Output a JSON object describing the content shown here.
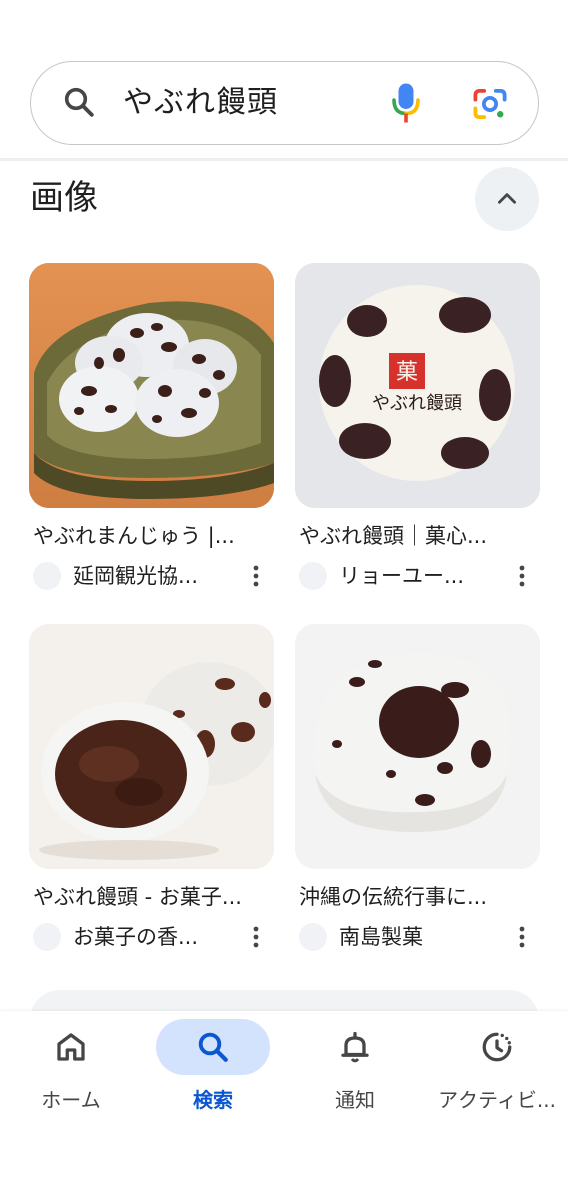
{
  "search": {
    "query": "やぶれ饅頭"
  },
  "images_section": {
    "title": "画像",
    "results": [
      {
        "title": "やぶれまんじゅう |...",
        "source": "延岡観光協..."
      },
      {
        "title": "やぶれ饅頭｜菓心...",
        "source": "リョーユー...",
        "stamp_text": "やぶれ饅頭"
      },
      {
        "title": "やぶれ饅頭 - お菓子...",
        "source": "お菓子の香..."
      },
      {
        "title": "沖縄の伝統行事に...",
        "source": "南島製菓"
      }
    ]
  },
  "bottom_nav": {
    "items": [
      {
        "label": "ホーム",
        "icon": "home-icon"
      },
      {
        "label": "検索",
        "icon": "search-icon",
        "active": true
      },
      {
        "label": "通知",
        "icon": "bell-icon"
      },
      {
        "label": "アクティビ...",
        "icon": "activity-icon"
      }
    ]
  },
  "colors": {
    "accent": "#0b57d0",
    "active_pill": "#d3e3fd",
    "mic_blue": "#4285f4",
    "mic_red": "#ea4335",
    "lens_yellow": "#fbbc04",
    "lens_green": "#34a853"
  }
}
